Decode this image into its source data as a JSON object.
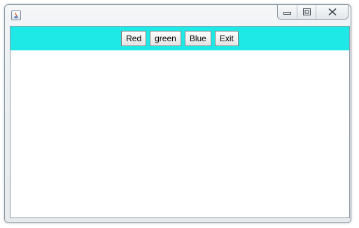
{
  "window": {
    "icon": "java-icon",
    "controls": {
      "minimize": "minimize-icon",
      "maximize": "maximize-icon",
      "close": "close-icon"
    }
  },
  "toolbar": {
    "background": "#1ee9e6",
    "buttons": [
      {
        "label": "Red"
      },
      {
        "label": "green"
      },
      {
        "label": "Blue"
      },
      {
        "label": "Exit"
      }
    ]
  },
  "content": {
    "background": "#ffffff"
  }
}
